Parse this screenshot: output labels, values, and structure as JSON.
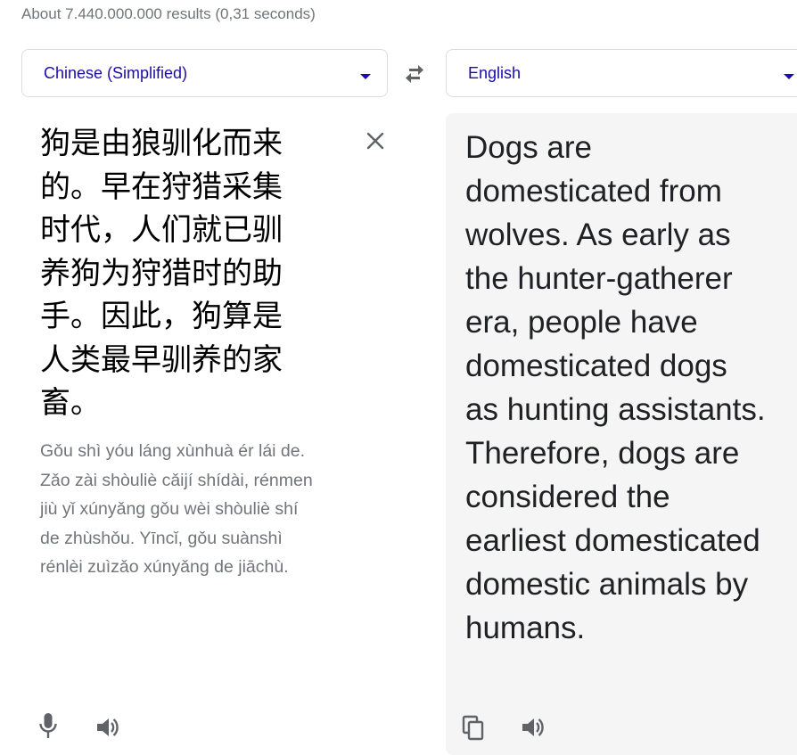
{
  "results_stats": "About 7.440.000.000 results (0,31 seconds)",
  "source_language": {
    "label": "Chinese (Simplified)",
    "icon": "chevron-down-icon"
  },
  "target_language": {
    "label": "English",
    "icon": "chevron-down-icon"
  },
  "swap_icon": "swap-horiz-icon",
  "source": {
    "text": "狗是由狼驯化而来的。早在狩猎采集时代，人们就已驯养狗为狩猎时的助手。因此，狗算是人类最早驯养的家畜。",
    "romanization": "Gǒu shì yóu láng xùnhuà ér lái de. Zǎo zài shòuliè cǎijí shídài, rénmen jiù yǐ xúnyǎng gǒu wèi shòuliè shí de zhùshǒu. Yīncǐ, gǒu suànshì rénlèi zuìzǎo xúnyǎng de jiāchù.",
    "clear_icon": "close-icon",
    "actions": [
      "microphone-icon",
      "speaker-icon"
    ]
  },
  "target": {
    "text": "Dogs are\ndomesticated from\nwolves. As early as\nthe hunter-gatherer\nera, people have\ndomesticated dogs\nas hunting assistants.\nTherefore, dogs are\nconsidered the\nearliest domesticated\ndomestic animals by\nhumans.",
    "actions": [
      "copy-icon",
      "speaker-icon"
    ]
  },
  "colors": {
    "link_blue": "#1a0dab",
    "muted_gray": "#70757a",
    "icon_gray": "#5f6368",
    "target_bg": "#f5f5f5",
    "border": "#dadce0"
  }
}
